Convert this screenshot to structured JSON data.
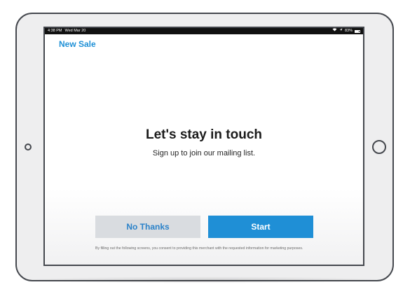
{
  "status_bar": {
    "time": "4:38 PM",
    "date": "Wed Mar 20",
    "battery": "83%",
    "wifi_icon": "wifi-icon",
    "location_icon": "location-arrow-icon"
  },
  "nav": {
    "back_label": "New Sale"
  },
  "main": {
    "title": "Let's stay in touch",
    "subtitle": "Sign up to join our mailing list."
  },
  "actions": {
    "decline_label": "No Thanks",
    "start_label": "Start"
  },
  "consent": {
    "text": "By filling out the following screens, you consent to providing this merchant with the requested information for marketing purposes."
  },
  "colors": {
    "accent": "#1f8fd6",
    "secondary_button": "#d9dce0",
    "device_frame": "#45484e"
  }
}
